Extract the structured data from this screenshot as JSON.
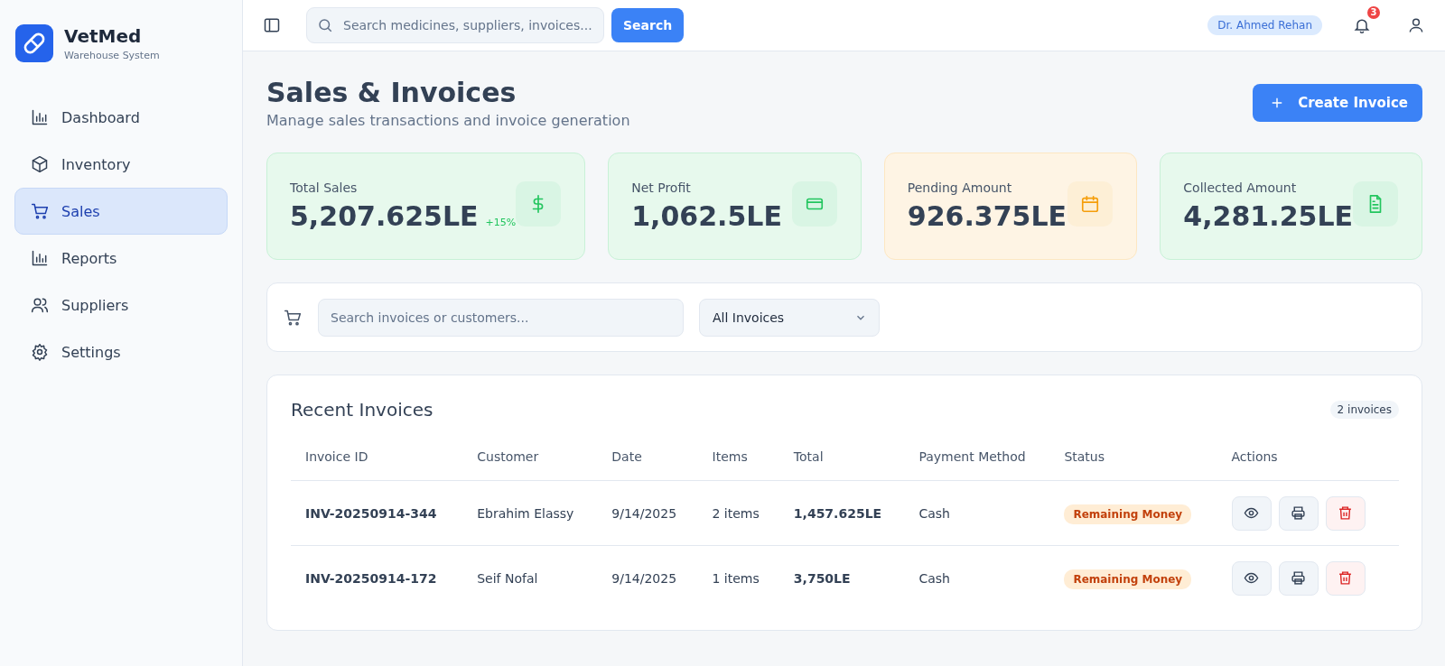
{
  "brand": {
    "name": "VetMed",
    "subtitle": "Warehouse System"
  },
  "sidebar": {
    "items": [
      {
        "label": "Dashboard",
        "selected": false
      },
      {
        "label": "Inventory",
        "selected": false
      },
      {
        "label": "Sales",
        "selected": true
      },
      {
        "label": "Reports",
        "selected": false
      },
      {
        "label": "Suppliers",
        "selected": false
      },
      {
        "label": "Settings",
        "selected": false
      }
    ]
  },
  "header": {
    "search": {
      "placeholder": "Search medicines, suppliers, invoices..."
    },
    "search_button": "Search",
    "user": "Dr. Ahmed Rehan",
    "notifications": "3"
  },
  "page": {
    "title": "Sales & Invoices",
    "subtitle": "Manage sales transactions and invoice generation",
    "create_button": "Create Invoice"
  },
  "stats": [
    {
      "label": "Total Sales",
      "value": "5,207.625LE",
      "change": "+15%",
      "color": "#22c55e"
    },
    {
      "label": "Net Profit",
      "value": "1,062.5LE",
      "color": "#22c55e"
    },
    {
      "label": "Pending Amount",
      "value": "926.375LE",
      "color": "#f59e0b"
    },
    {
      "label": "Collected Amount",
      "value": "4,281.25LE",
      "color": "#22c55e"
    }
  ],
  "filters": {
    "search": {
      "placeholder": "Search invoices or customers..."
    },
    "dropdown": "All Invoices"
  },
  "table": {
    "title": "Recent Invoices",
    "count": "2 invoices",
    "columns": [
      "Invoice ID",
      "Customer",
      "Date",
      "Items",
      "Total",
      "Payment Method",
      "Status",
      "Actions"
    ],
    "rows": [
      {
        "id": "INV-20250914-344",
        "customer": "Ebrahim Elassy",
        "date": "9/14/2025",
        "items": "2 items",
        "total": "1,457.625LE",
        "method": "Cash",
        "status": "Remaining Money"
      },
      {
        "id": "INV-20250914-172",
        "customer": "Seif Nofal",
        "date": "9/14/2025",
        "items": "1 items",
        "total": "3,750LE",
        "method": "Cash",
        "status": "Remaining Money"
      }
    ]
  }
}
